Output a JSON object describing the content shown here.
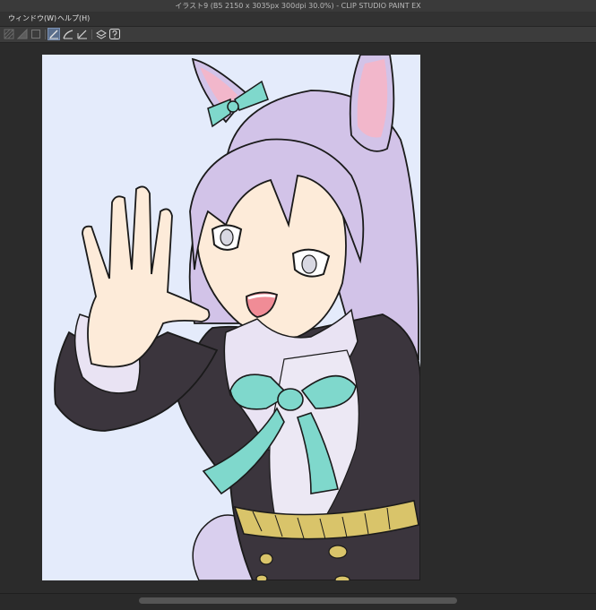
{
  "window": {
    "title": "イラスト9 (B5 2150 x 3035px 300dpi 30.0%)  - CLIP STUDIO PAINT EX"
  },
  "menu": {
    "items": [
      {
        "label": "ウィンドウ(W)"
      },
      {
        "label": "ヘルプ(H)"
      }
    ]
  },
  "toolbar": {
    "buttons": [
      {
        "icon": "hatched-square-icon",
        "active": false
      },
      {
        "icon": "ruler-triangle-icon",
        "active": false
      },
      {
        "icon": "square-outline-icon",
        "active": false
      },
      {
        "icon": "pen-check-icon",
        "active": true
      },
      {
        "icon": "curve-pen-icon",
        "active": false
      },
      {
        "icon": "ruler-pen-icon",
        "active": false
      },
      {
        "icon": "layer-stack-icon",
        "active": false
      },
      {
        "icon": "help-icon",
        "active": false
      }
    ]
  },
  "canvas": {
    "content": "illustration",
    "colors": {
      "background": "#e4ebfb",
      "hair": "#d2c3e8",
      "skin": "#fdebd9",
      "jacket": "#3b353d",
      "ribbon": "#7fd8cc",
      "frill": "#e9e3f3",
      "gold": "#d9c46a",
      "ear_inner": "#f2b7cb",
      "mouth": "#f08c96"
    }
  },
  "scrollbar": {
    "orientation": "horizontal"
  }
}
